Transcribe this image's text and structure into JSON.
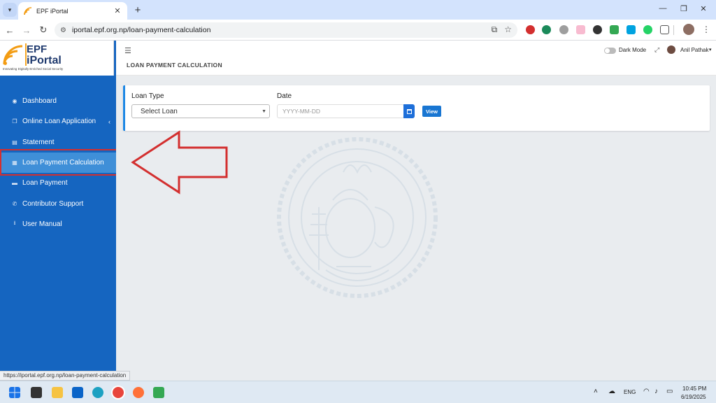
{
  "browser": {
    "tab_title": "EPF iPortal",
    "url": "iportal.epf.org.np/loan-payment-calculation",
    "status_url": "https://iportal.epf.org.np/loan-payment-calculation",
    "tab_close": "✕",
    "new_tab": "+",
    "minimize": "—",
    "restore": "❐",
    "close": "✕"
  },
  "logo": {
    "line1": "EPF",
    "line2": "iPortal",
    "tagline": "Innovating Digitally Enriched Social Security"
  },
  "sidebar": {
    "items": [
      {
        "label": "Dashboard",
        "icon": "dashboard-icon",
        "glyph": "◉"
      },
      {
        "label": "Online Loan Application",
        "icon": "copy-icon",
        "glyph": "❐"
      },
      {
        "label": "Statement",
        "icon": "file-icon",
        "glyph": "▤"
      },
      {
        "label": "Loan Payment Calculation",
        "icon": "calculator-icon",
        "glyph": "▦"
      },
      {
        "label": "Loan Payment",
        "icon": "credit-card-icon",
        "glyph": "▬"
      },
      {
        "label": "Contributor Support",
        "icon": "phone-icon",
        "glyph": "✆"
      },
      {
        "label": "User Manual",
        "icon": "download-icon",
        "glyph": "⭳"
      }
    ],
    "active_index": 3
  },
  "header": {
    "page_title": "LOAN PAYMENT CALCULATION",
    "dark_mode_label": "Dark Mode",
    "user_name": "Anil Pathak"
  },
  "form": {
    "loan_type_label": "Loan Type",
    "loan_type_value": "Select Loan",
    "date_label": "Date",
    "date_placeholder": "YYYY-MM-DD",
    "view_label": "View"
  },
  "taskbar": {
    "language": "ENG",
    "time": "10:45 PM",
    "date": "6/19/2025"
  },
  "colors": {
    "sidebar": "#1565c0",
    "active_item": "#3f8fd8",
    "annotation": "#d32f2f",
    "primary_button": "#1976d2"
  }
}
